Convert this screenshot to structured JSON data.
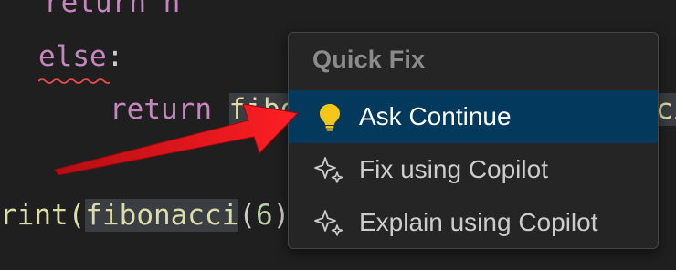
{
  "editor": {
    "lines": {
      "l1": {
        "text": "  return n"
      },
      "l2": {
        "kw": "else",
        "colon": ":"
      },
      "l3": {
        "kw": "return",
        "fn": "fibo",
        "tail": "ci"
      },
      "l4": {
        "pre": "rint(",
        "fn": "fibonacci",
        "arg_open": "(",
        "num": "6",
        "close": ")"
      }
    }
  },
  "quick_fix": {
    "title": "Quick Fix",
    "items": [
      {
        "label": "Ask Continue",
        "icon": "lightbulb-icon",
        "selected": true
      },
      {
        "label": "Fix using Copilot",
        "icon": "sparkle-icon",
        "selected": false
      },
      {
        "label": "Explain using Copilot",
        "icon": "sparkle-icon",
        "selected": false
      }
    ]
  },
  "colors": {
    "background": "#1f1f1f",
    "popup_background": "#252526",
    "selection": "#04395e",
    "keyword": "#c586c0",
    "function": "#dcdcaa",
    "number": "#b5cea8",
    "annotation_arrow": "#e0151b"
  }
}
